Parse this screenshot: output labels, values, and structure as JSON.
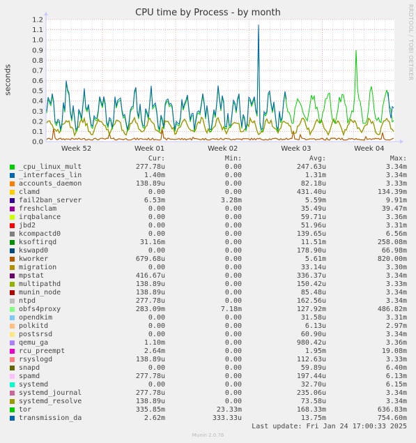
{
  "chart_data": {
    "type": "line",
    "title": "CPU time by Process - by month",
    "ylabel": "seconds",
    "xlabel": "",
    "vendor_label": "RRDTOOL / TOBI OETIKER",
    "ylim": [
      0,
      1.2
    ],
    "yticks": [
      "0.0",
      "0.1",
      "0.2",
      "0.3",
      "0.4",
      "0.5",
      "0.6",
      "0.7",
      "0.8",
      "0.9",
      "1.0",
      "1.1",
      "1.2"
    ],
    "xticks": [
      "Week 52",
      "Week 01",
      "Week 02",
      "Week 03",
      "Week 04"
    ],
    "grid": true,
    "colors": {
      "background": "#f0f0f0",
      "plot_bg": "#ffffff",
      "major_grid": "#e8a0a0",
      "minor_grid": "#d0d0d0",
      "axis": "#c8c8ff"
    },
    "series_approx": [
      {
        "name": "transmission_da",
        "color": "#0066b3",
        "profile": "dominant-until-week03",
        "peak": 1.15,
        "typical": [
          0.15,
          0.45
        ]
      },
      {
        "name": "_cpu_linux_mult",
        "color": "#00cc00",
        "profile": "dominant-after-week03",
        "peak": 0.9,
        "typical": [
          0.2,
          0.5
        ]
      },
      {
        "name": "systemd_resolve",
        "color": "#999900",
        "profile": "steady",
        "typical": [
          0.08,
          0.25
        ]
      },
      {
        "name": "kworker",
        "color": "#b35a00",
        "profile": "spiky-low",
        "typical": [
          0.0,
          0.06
        ]
      }
    ],
    "legend": {
      "headers": {
        "cur": "Cur:",
        "min": "Min:",
        "avg": "Avg:",
        "max": "Max:"
      },
      "rows": [
        {
          "name": "_cpu_linux_mult",
          "color": "#00cc00",
          "cur": "277.78u",
          "min": "0.00",
          "avg": "247.63u",
          "max": "3.34m"
        },
        {
          "name": "_interfaces_lin",
          "color": "#0066b3",
          "cur": "1.40m",
          "min": "0.00",
          "avg": "1.31m",
          "max": "3.34m"
        },
        {
          "name": "accounts_daemon",
          "color": "#ff8000",
          "cur": "138.89u",
          "min": "0.00",
          "avg": "82.18u",
          "max": "3.33m"
        },
        {
          "name": "clamd",
          "color": "#ffcc00",
          "cur": "0.00",
          "min": "0.00",
          "avg": "431.40u",
          "max": "134.39m"
        },
        {
          "name": "fail2ban_server",
          "color": "#330099",
          "cur": "6.53m",
          "min": "3.28m",
          "avg": "5.59m",
          "max": "9.91m"
        },
        {
          "name": "freshclam",
          "color": "#990099",
          "cur": "0.00",
          "min": "0.00",
          "avg": "35.49u",
          "max": "39.47m"
        },
        {
          "name": "irqbalance",
          "color": "#ccff00",
          "cur": "0.00",
          "min": "0.00",
          "avg": "59.71u",
          "max": "3.36m"
        },
        {
          "name": "jbd2",
          "color": "#ff0000",
          "cur": "0.00",
          "min": "0.00",
          "avg": "51.96u",
          "max": "3.31m"
        },
        {
          "name": "kcompactd0",
          "color": "#808080",
          "cur": "0.00",
          "min": "0.00",
          "avg": "139.65u",
          "max": "6.56m"
        },
        {
          "name": "ksoftirqd",
          "color": "#008f00",
          "cur": "31.16m",
          "min": "0.00",
          "avg": "11.51m",
          "max": "258.08m"
        },
        {
          "name": "kswapd0",
          "color": "#00487d",
          "cur": "0.00",
          "min": "0.00",
          "avg": "178.90u",
          "max": "66.98m"
        },
        {
          "name": "kworker",
          "color": "#b35a00",
          "cur": "679.68u",
          "min": "0.00",
          "avg": "5.61m",
          "max": "820.00m"
        },
        {
          "name": "migration",
          "color": "#b38f00",
          "cur": "0.00",
          "min": "0.00",
          "avg": "33.14u",
          "max": "3.30m"
        },
        {
          "name": "mpstat",
          "color": "#6b006b",
          "cur": "416.67u",
          "min": "0.00",
          "avg": "336.37u",
          "max": "3.34m"
        },
        {
          "name": "multipathd",
          "color": "#8fb300",
          "cur": "138.89u",
          "min": "0.00",
          "avg": "150.42u",
          "max": "3.33m"
        },
        {
          "name": "munin_node",
          "color": "#b30000",
          "cur": "138.89u",
          "min": "0.00",
          "avg": "85.48u",
          "max": "3.34m"
        },
        {
          "name": "ntpd",
          "color": "#bebebe",
          "cur": "277.78u",
          "min": "0.00",
          "avg": "162.56u",
          "max": "3.34m"
        },
        {
          "name": "obfs4proxy",
          "color": "#80ff80",
          "cur": "283.09m",
          "min": "7.18m",
          "avg": "127.92m",
          "max": "486.82m"
        },
        {
          "name": "opendkim",
          "color": "#80c9ff",
          "cur": "0.00",
          "min": "0.00",
          "avg": "31.58u",
          "max": "3.31m"
        },
        {
          "name": "polkitd",
          "color": "#ffc080",
          "cur": "0.00",
          "min": "0.00",
          "avg": "6.13u",
          "max": "2.97m"
        },
        {
          "name": "postsrsd",
          "color": "#ffe680",
          "cur": "0.00",
          "min": "0.00",
          "avg": "60.90u",
          "max": "3.34m"
        },
        {
          "name": "qemu_ga",
          "color": "#aa80ff",
          "cur": "1.10m",
          "min": "0.00",
          "avg": "980.42u",
          "max": "3.36m"
        },
        {
          "name": "rcu_preempt",
          "color": "#ee00cc",
          "cur": "2.64m",
          "min": "0.00",
          "avg": "1.95m",
          "max": "19.08m"
        },
        {
          "name": "rsyslogd",
          "color": "#ff8080",
          "cur": "138.89u",
          "min": "0.00",
          "avg": "112.63u",
          "max": "3.33m"
        },
        {
          "name": "snapd",
          "color": "#666600",
          "cur": "0.00",
          "min": "0.00",
          "avg": "59.89u",
          "max": "6.40m"
        },
        {
          "name": "spamd",
          "color": "#ffbfff",
          "cur": "277.78u",
          "min": "0.00",
          "avg": "197.44u",
          "max": "6.13m"
        },
        {
          "name": "systemd",
          "color": "#00ffcc",
          "cur": "0.00",
          "min": "0.00",
          "avg": "32.70u",
          "max": "6.15m"
        },
        {
          "name": "systemd_journal",
          "color": "#cc6699",
          "cur": "277.78u",
          "min": "0.00",
          "avg": "235.06u",
          "max": "3.34m"
        },
        {
          "name": "systemd_resolve",
          "color": "#999900",
          "cur": "138.89u",
          "min": "0.00",
          "avg": "73.58u",
          "max": "3.34m"
        },
        {
          "name": "tor",
          "color": "#00cc00",
          "cur": "335.85m",
          "min": "23.33m",
          "avg": "168.33m",
          "max": "636.83m"
        },
        {
          "name": "transmission_da",
          "color": "#0066b3",
          "cur": "2.62m",
          "min": "333.33u",
          "avg": "13.75m",
          "max": "754.60m"
        }
      ]
    }
  },
  "footer": {
    "last_update": "Last update: Fri Jan 24 17:00:33 2025",
    "munin_version": "Munin 2.0.76"
  }
}
